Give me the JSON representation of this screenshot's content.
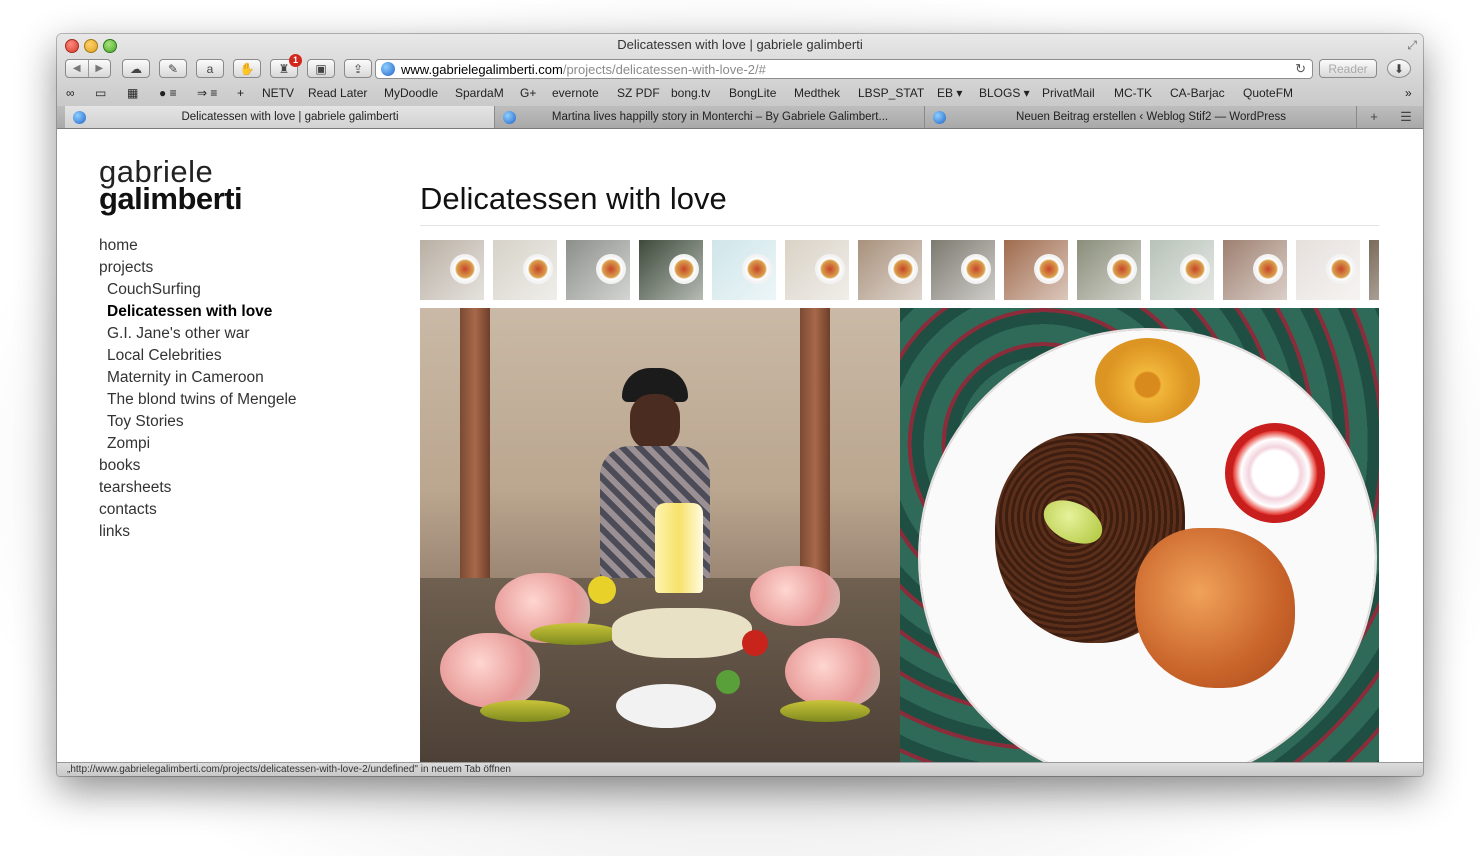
{
  "window": {
    "title": "Delicatessen with love | gabriele galimberti"
  },
  "toolbar": {
    "url_host": "www.gabrielegalimberti.com",
    "url_path": "/projects/delicatessen-with-love-2/#",
    "reader_label": "Reader",
    "notification_count": "1"
  },
  "bookmarks": [
    "NETV",
    "Read Later",
    "MyDoodle",
    "SpardaM",
    "G+",
    "evernote",
    "SZ PDF",
    "bong.tv",
    "BongLite",
    "Medthek",
    "LBSP_STAT",
    "EB ▾",
    "BLOGS ▾",
    "PrivatMail",
    "MC-TK",
    "CA-Barjac",
    "QuoteFM"
  ],
  "tabs": [
    {
      "label": "Delicatessen with love | gabriele galimberti",
      "active": true
    },
    {
      "label": "Martina lives happilly story in Monterchi – By Gabriele Galimbert...",
      "active": false
    },
    {
      "label": "Neuen Beitrag erstellen ‹ Weblog Stif2 — WordPress",
      "active": false
    }
  ],
  "site": {
    "logo_light": "gabriele",
    "logo_bold": "galimberti",
    "nav": {
      "home": "home",
      "projects": "projects",
      "sub": [
        "CouchSurfing",
        "Delicatessen with love",
        "G.I. Jane's other war",
        "Local Celebrities",
        "Maternity in Cameroon",
        "The blond twins of Mengele",
        "Toy Stories",
        "Zompi"
      ],
      "books": "books",
      "tearsheets": "tearsheets",
      "contacts": "contacts",
      "links": "links"
    },
    "page_title": "Delicatessen with love"
  },
  "status_bar": "„http://www.gabrielegalimberti.com/projects/delicatessen-with-love-2/undefined\" in neuem Tab öffnen",
  "colors": {
    "thumb_backgrounds": [
      "#b9b0a4",
      "#d6d2c8",
      "#8c8f8a",
      "#3d4a3a",
      "#cfe6ea",
      "#d9d2c6",
      "#a8917c",
      "#7d7a70",
      "#a06b4d",
      "#8a8e7a",
      "#b8c2b8",
      "#9e8070",
      "#e6e0dc",
      "#7a6a5a"
    ]
  }
}
